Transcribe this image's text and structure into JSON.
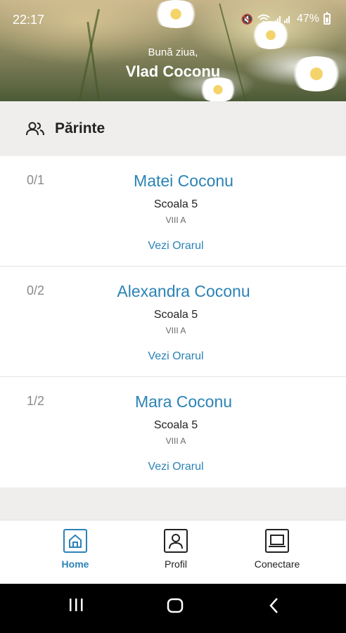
{
  "status_bar": {
    "time": "22:17",
    "battery": "47%"
  },
  "header": {
    "greeting": "Bună ziua,",
    "user_name": "Vlad Coconu"
  },
  "section": {
    "title": "Părinte"
  },
  "children": [
    {
      "index": "0/1",
      "name": "Matei Coconu",
      "school": "Scoala 5",
      "class": "VIII A",
      "link": "Vezi Orarul"
    },
    {
      "index": "0/2",
      "name": "Alexandra Coconu",
      "school": "Scoala 5",
      "class": "VIII A",
      "link": "Vezi Orarul"
    },
    {
      "index": "1/2",
      "name": "Mara Coconu",
      "school": "Scoala 5",
      "class": "VIII A",
      "link": "Vezi Orarul"
    }
  ],
  "tabbar": {
    "home": {
      "label": "Home",
      "icon": "home-icon"
    },
    "profile": {
      "label": "Profil",
      "icon": "user-icon"
    },
    "connect": {
      "label": "Conectare",
      "icon": "laptop-icon"
    }
  },
  "colors": {
    "accent": "#2a83b6",
    "background": "#efeeec"
  }
}
